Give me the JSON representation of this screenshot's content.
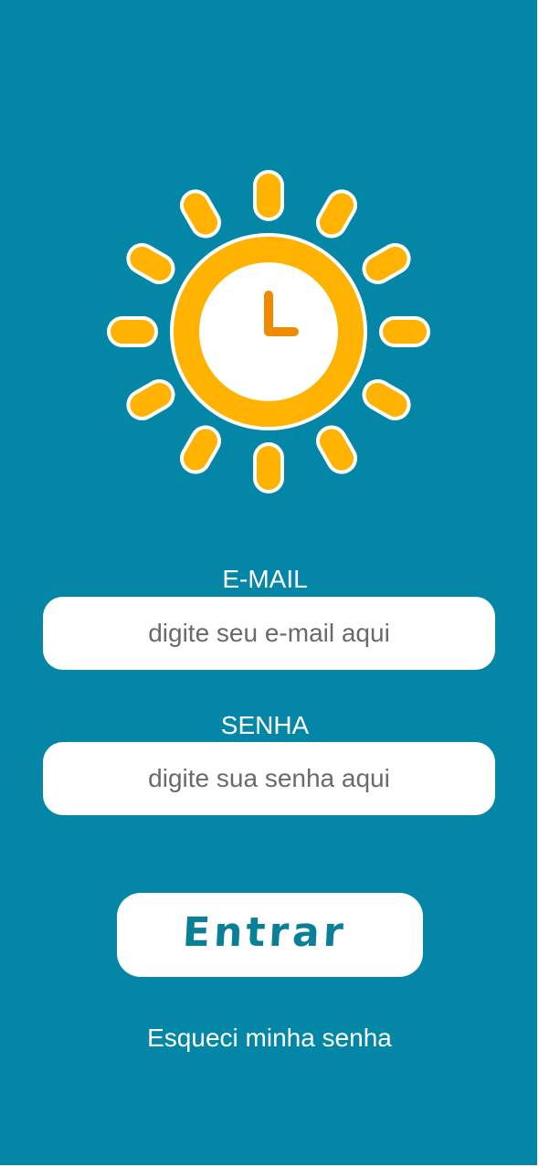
{
  "logo": {
    "icon": "sun-clock-icon",
    "colors": {
      "ray": "#ffb300",
      "ring": "#ffb300",
      "face": "#ffffff",
      "hands": "#f08a00",
      "outline": "#ffffff"
    }
  },
  "form": {
    "email": {
      "label": "E-MAIL",
      "placeholder": "digite seu e-mail aqui",
      "value": ""
    },
    "password": {
      "label": "SENHA",
      "placeholder": "digite sua senha aqui",
      "value": ""
    },
    "submit_label": "Entrar",
    "forgot_label": "Esqueci minha senha"
  },
  "colors": {
    "background": "#0487a6",
    "button_text": "#0a7f98",
    "field_background": "#ffffff"
  }
}
